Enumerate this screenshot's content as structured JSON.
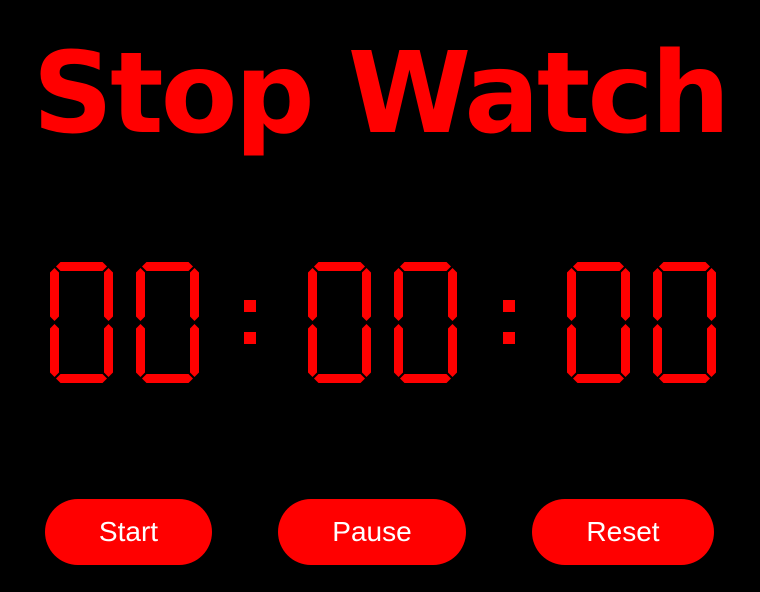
{
  "title": "Stop Watch",
  "display": {
    "hours": "00",
    "minutes": "00",
    "seconds": "00",
    "separator": ":"
  },
  "buttons": {
    "start": "Start",
    "pause": "Pause",
    "reset": "Reset"
  },
  "colors": {
    "background": "#000000",
    "accent": "#ff0000",
    "button_text": "#ffffff"
  }
}
